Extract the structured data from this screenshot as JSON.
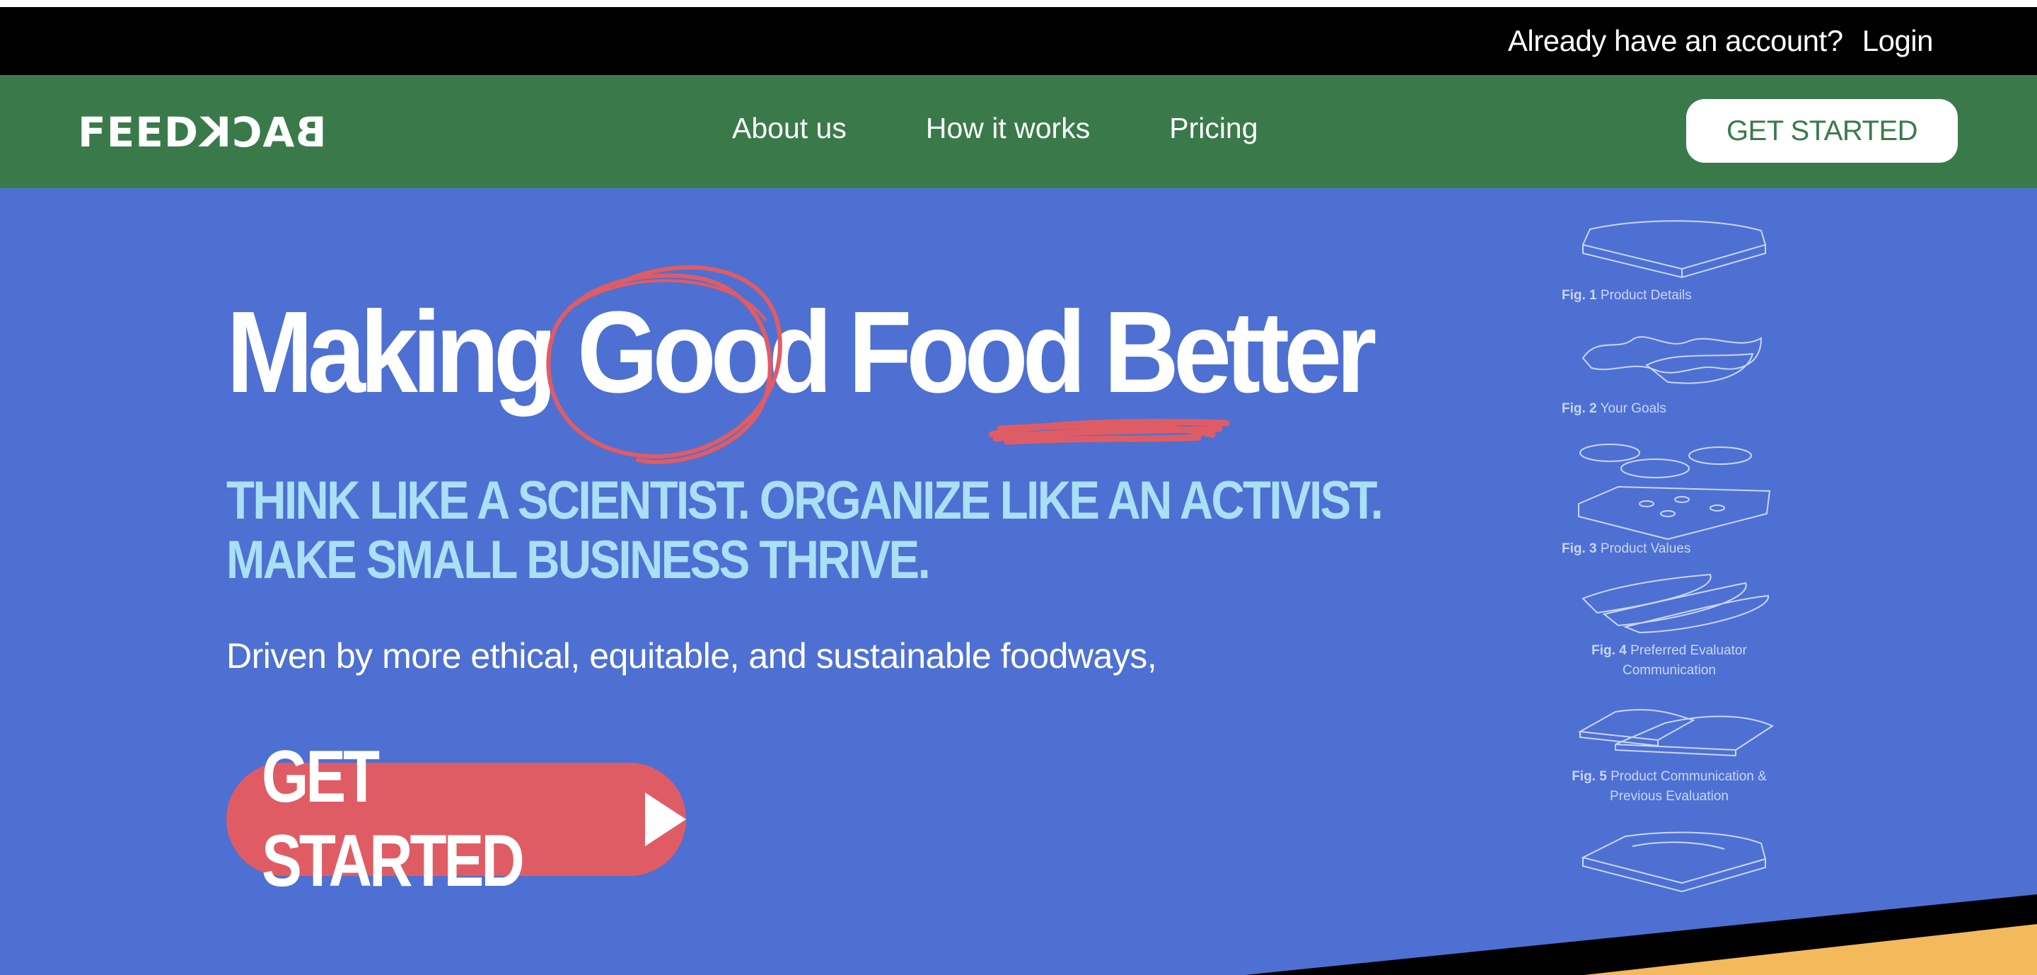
{
  "topbar": {
    "question": "Already have an account?",
    "login": "Login"
  },
  "nav": {
    "logo_left": "FEED",
    "logo_right": "BACK",
    "links": [
      "About us",
      "How it works",
      "Pricing"
    ],
    "cta": "GET STARTED"
  },
  "hero": {
    "headline": {
      "w1": "Making",
      "w2": "Good",
      "w3": "Food",
      "w4": "Better"
    },
    "subline": [
      "THINK LIKE A SCIENTIST. ORGANIZE LIKE AN ACTIVIST.",
      "MAKE SMALL BUSINESS THRIVE."
    ],
    "driven": "Driven by more ethical, equitable, and sustainable foodways,",
    "cta": "GET STARTED"
  },
  "figures": [
    {
      "num": "Fig. 1",
      "label": "Product Details"
    },
    {
      "num": "Fig. 2",
      "label": "Your Goals"
    },
    {
      "num": "Fig. 3",
      "label": "Product Values"
    },
    {
      "num": "Fig. 4",
      "label": "Preferred Evaluator",
      "label2": "Communication"
    },
    {
      "num": "Fig. 5",
      "label": "Product Communication &",
      "label2": "Previous Evaluation"
    }
  ],
  "colors": {
    "topbar": "#000000",
    "nav": "#3a7a4a",
    "hero": "#4e70d3",
    "accent_red": "#e05c64",
    "subline": "#a9e0f5",
    "yellow": "#f3b95b"
  }
}
